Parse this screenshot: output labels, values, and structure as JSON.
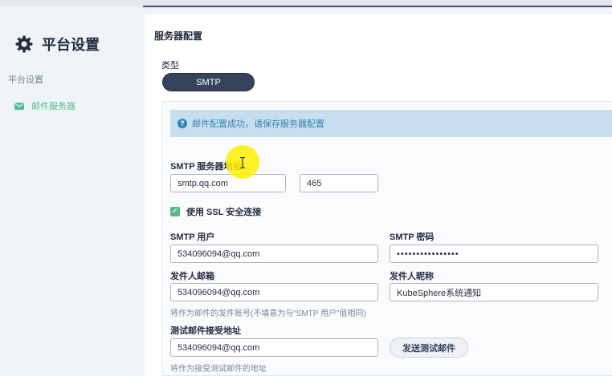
{
  "sidebar": {
    "title": "平台设置",
    "group_label": "平台设置",
    "items": [
      {
        "label": "邮件服务器",
        "icon": "mail-icon",
        "active": true
      }
    ]
  },
  "main": {
    "section_title": "服务器配置",
    "type_label": "类型",
    "type_value": "SMTP",
    "alert": {
      "icon": "info-icon",
      "text": "邮件配置成功，请保存服务器配置"
    },
    "smtp_server": {
      "label": "SMTP 服务器地址",
      "host": "smtp.qq.com",
      "port": "465"
    },
    "ssl": {
      "label": "使用 SSL 安全连接",
      "checked": true
    },
    "smtp_user": {
      "label": "SMTP 用户",
      "value": "534096094@qq.com"
    },
    "smtp_password": {
      "label": "SMTP 密码",
      "value": "••••••••••••••••"
    },
    "sender_email": {
      "label": "发件人邮箱",
      "value": "534096094@qq.com",
      "help": "将作为邮件的发件账号(不填意为与“SMTP 用户”值相同)"
    },
    "sender_name": {
      "label": "发件人昵称",
      "value": "KubeSphere系统通知"
    },
    "test_email": {
      "label": "测试邮件接受地址",
      "value": "534096094@qq.com",
      "help": "将作为接受测试邮件的地址",
      "button": "发送测试邮件"
    }
  },
  "colors": {
    "accent_green": "#55bc8a",
    "dark": "#242e42",
    "info_blue": "#3385b0",
    "alert_bg": "#c7deef"
  }
}
